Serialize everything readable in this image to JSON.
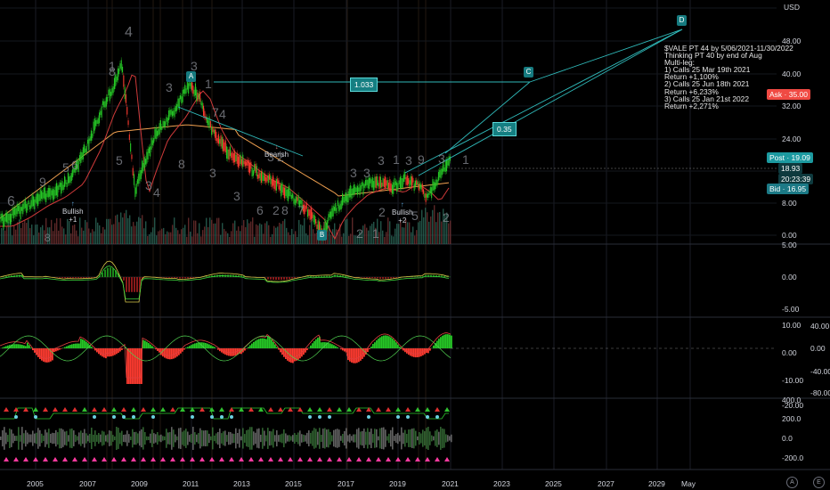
{
  "price_axis": {
    "currency": "USD",
    "labels": [
      "5",
      "48.00",
      "40.00",
      "32.00",
      "24.00",
      "16.00",
      "8.00",
      "0.00"
    ],
    "ask_label": "Ask · 35.00",
    "post_label": "Post · 19.09",
    "last_price": "18.93",
    "countdown": "20:23:39",
    "bid_label": "Bid · 16.95"
  },
  "osc1_axis": {
    "labels": [
      "5.00",
      "0.00",
      "-5.00"
    ]
  },
  "osc2_axis": {
    "labels": [
      "10.00",
      "0.00",
      "-10.00",
      "-20.00"
    ],
    "right_labels": [
      "40.00",
      "0.00",
      "-40.00",
      "-80.00"
    ]
  },
  "osc3_axis": {
    "labels": [
      "400.0",
      "200.0",
      "0.0",
      "-200.0"
    ]
  },
  "time_axis": {
    "labels": [
      "2005",
      "2007",
      "2009",
      "2011",
      "2013",
      "2015",
      "2017",
      "2019",
      "2021",
      "2023",
      "2025",
      "2027",
      "2029",
      "May"
    ]
  },
  "annotation": {
    "lines": [
      "$VALE PT 44 by 5/06/2021-11/30/2022",
      "Thinking PT 40 by end of Aug",
      "Multi-leg:",
      "1) Calls 25 Mar 19th 2021",
      "Return +1,100%",
      "2) Calls 25 Jun 18th 2021",
      "Return +6,233%",
      "3) Calls 25 Jan 21st 2022",
      "Return +2,271%"
    ]
  },
  "fib_labels": {
    "f1": "1.033",
    "f2": "0.35"
  },
  "waves": {
    "a": "A",
    "b": "B",
    "c": "C",
    "d": "D"
  },
  "signals": {
    "bullish1": "Bullish",
    "bullish1_n": "+1",
    "bearish": "Bearish",
    "bullish2": "Bullish",
    "bullish2_n": "+2"
  },
  "td_counts": [
    "6",
    "9",
    "5",
    "6",
    "1",
    "8",
    "4",
    "3",
    "3",
    "1",
    "7",
    "5",
    "4",
    "3",
    "8",
    "3",
    "3",
    "4",
    "3",
    "2",
    "6",
    "2",
    "8",
    "7",
    "3",
    "3",
    "3",
    "1",
    "3",
    "9",
    "3",
    "1",
    "2",
    "2",
    "1",
    "8",
    "2",
    "5"
  ],
  "corner_icons": {
    "a": "A",
    "e": "E"
  },
  "colors": {
    "background": "#000000",
    "up": "#26c826",
    "down": "#ff3b30",
    "ma_orange": "#f0a050",
    "ma_red": "#e04040",
    "trend_line": "#2fb8b8",
    "ask": "#f04a43",
    "post": "#1c9aa0",
    "bid": "#1c7a86"
  }
}
